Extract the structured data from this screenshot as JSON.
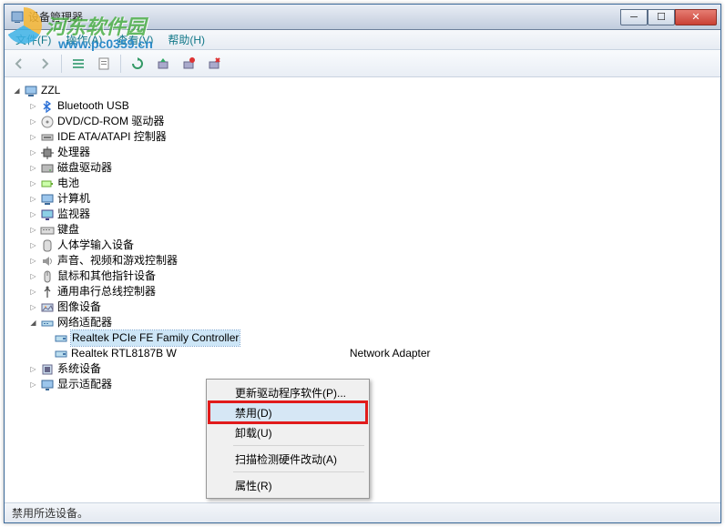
{
  "watermark": {
    "text": "河东软件园",
    "url": "www.pc0359.cn"
  },
  "window": {
    "title": "设备管理器"
  },
  "menubar": {
    "items": [
      {
        "label": "文件(F)"
      },
      {
        "label": "操作(A)"
      },
      {
        "label": "查看(V)"
      },
      {
        "label": "帮助(H)"
      }
    ]
  },
  "tree": {
    "root": {
      "label": "ZZL"
    },
    "categories": [
      {
        "label": "Bluetooth USB",
        "icon": "bluetooth-icon"
      },
      {
        "label": "DVD/CD-ROM 驱动器",
        "icon": "disc-icon"
      },
      {
        "label": "IDE ATA/ATAPI 控制器",
        "icon": "ide-icon"
      },
      {
        "label": "处理器",
        "icon": "cpu-icon"
      },
      {
        "label": "磁盘驱动器",
        "icon": "disk-icon"
      },
      {
        "label": "电池",
        "icon": "battery-icon"
      },
      {
        "label": "计算机",
        "icon": "computer-icon"
      },
      {
        "label": "监视器",
        "icon": "monitor-icon"
      },
      {
        "label": "键盘",
        "icon": "keyboard-icon"
      },
      {
        "label": "人体学输入设备",
        "icon": "hid-icon"
      },
      {
        "label": "声音、视频和游戏控制器",
        "icon": "sound-icon"
      },
      {
        "label": "鼠标和其他指针设备",
        "icon": "mouse-icon"
      },
      {
        "label": "通用串行总线控制器",
        "icon": "usb-icon"
      },
      {
        "label": "图像设备",
        "icon": "image-icon"
      }
    ],
    "network": {
      "label": "网络适配器",
      "children": [
        {
          "label": "Realtek PCIe FE Family Controller",
          "selected": true
        },
        {
          "label_prefix": "Realtek RTL8187B W",
          "label_suffix": "Network Adapter"
        }
      ]
    },
    "tail": [
      {
        "label": "系统设备",
        "icon": "system-icon"
      },
      {
        "label": "显示适配器",
        "icon": "display-icon"
      }
    ]
  },
  "contextmenu": {
    "items": [
      {
        "label": "更新驱动程序软件(P)..."
      },
      {
        "label": "禁用(D)",
        "highlighted": true
      },
      {
        "label": "卸载(U)"
      }
    ],
    "scan": {
      "label": "扫描检测硬件改动(A)"
    },
    "props": {
      "label": "属性(R)"
    }
  },
  "statusbar": {
    "text": "禁用所选设备。"
  }
}
